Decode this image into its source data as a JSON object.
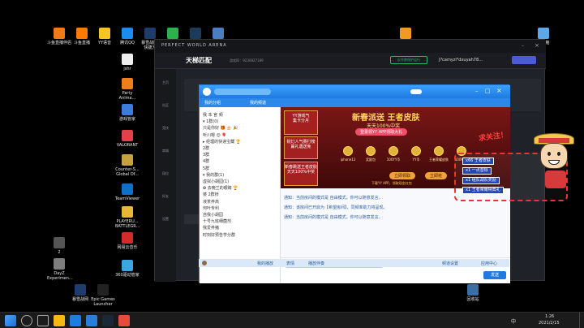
{
  "desktop_icons": [
    {
      "label": "斗鱼直播伴侣",
      "color": "#f07a1a"
    },
    {
      "label": "斗鱼直播",
      "color": "#ff7a00"
    },
    {
      "label": "YY语音",
      "color": "#f6c521"
    },
    {
      "label": "腾讯QQ",
      "color": "#1b8cf2"
    },
    {
      "label": "暴雪战网-\n快捷方",
      "color": "#1e3d6d"
    },
    {
      "label": "微信",
      "color": "#2bb24c"
    },
    {
      "label": "Steam",
      "color": "#1c3a5a"
    },
    {
      "label": "",
      "color": "#4a7fc1"
    }
  ],
  "left_icons": [
    {
      "label": "jshr",
      "color": "#eeeeee"
    },
    {
      "label": "Party\nAnima...",
      "color": "#ef7f1a"
    },
    {
      "label": "游戏管家",
      "color": "#3b7dd8"
    },
    {
      "label": "VALORANT",
      "color": "#e0424a"
    },
    {
      "label": "Counter-S...\nGlobal Of...",
      "color": "#c9a13e"
    },
    {
      "label": "TeamViewer",
      "color": "#0e70c8"
    },
    {
      "label": "PLAYERU...\nBATTLEGR...",
      "color": "#e8b638"
    },
    {
      "label": "网易云音乐",
      "color": "#d32a2a"
    },
    {
      "label": "2",
      "color": "#555555"
    },
    {
      "label": "DayZ\nExperimen...",
      "color": "#7d7d7d"
    },
    {
      "label": "360驱动管家",
      "color": "#3aa7e0"
    }
  ],
  "bottom_icons": [
    {
      "label": "暴雪战网",
      "color": "#1e3d6d"
    },
    {
      "label": "Epic Games\nLauncher",
      "color": "#222222"
    }
  ],
  "right_icons": [
    {
      "label": "",
      "color": "#f19a1d"
    },
    {
      "label": "此电脑",
      "color": "#5fa8e8"
    },
    {
      "label": "回收站",
      "color": "#3a6ea5"
    }
  ],
  "pw": {
    "brand": "PERFECT WORLD ARENA",
    "nav_title": "天梯匹配",
    "id_text": "游戏ID：9230827189",
    "status": "反作弊保护运行",
    "user": "J?camyzi*dxuyah78...",
    "sidebar": [
      "主页",
      "社区",
      "竞技",
      "商城",
      "段位",
      "好友",
      "设置"
    ]
  },
  "qq": {
    "title": "",
    "sidebar_title": "我的分组",
    "sidebar_header": "我的频道",
    "tree": [
      "  我 本 官 频",
      "▾ 1群(0)",
      "  只是你好 🎁 🎂 🎉",
      "  听川嗯 😊 🎈",
      "  ▸ 经理的快递宝藏 🏆",
      "  2群",
      "  3群",
      "  4群",
      "  5群",
      "▾ 我的群(1)",
      "    虚拟小胡园(1)",
      "    ✿ 去晚兰的眼睛 🏆",
      "    婆 2群桥",
      "    液茶养高",
      "    何叶专利",
      "    自我小胡园",
      "    十号九班细菌剂",
      "    我爱养猪",
      "    时刻好预告学分群"
    ],
    "promo": {
      "left1": "YY游戏气\n集卡分月",
      "left1b": "2.1~2.18",
      "left2": "财灯人气赛打榜\n赢礼遇送免",
      "left2b": "2.1~2.18",
      "left3": "新春跳送王者皮肤\n天天100%中奖",
      "left3b": "2.11~2.18",
      "headline": "新春派送 王者皮肤",
      "sub": "天天100%中奖",
      "btn": "登录领YY APP领取大礼",
      "items": [
        "iphone12",
        "奖励包",
        "100YY币",
        "YY币",
        "王者荣耀皮肤",
        "100YY币"
      ],
      "claim": "立即领取",
      "claim2": "立即抢",
      "app": "下载YY APP，领取现金红包"
    },
    "messages": [
      "通知：当前房间的模式是 自由模式，你可以随意发言。",
      "通知：该房间已开启为【希望房间】，同频率助力将呈现。",
      "通知：当前房间的模式是 自由模式，你可以随意发言。"
    ],
    "input_tip": "按检测到您尚未正常连接，建议切换到单向连接，或 查看音频设置",
    "toolbar": [
      "我的播放",
      "表情",
      "播放伴奏",
      "发送",
      "频道设置",
      "应用中心"
    ],
    "bottom_bar": [
      "播放伴奏",
      "播放中",
      "应用中心"
    ]
  },
  "luffy": {
    "title": "求关注！",
    "lines": [
      "x66 王者皮肤",
      "x1 一点音标",
      "x1 组队战队奖励",
      "x1 王者荣耀特典礼"
    ]
  },
  "taskbar": {
    "time": "1:26",
    "date": "2021/2/15",
    "lang": "中"
  }
}
